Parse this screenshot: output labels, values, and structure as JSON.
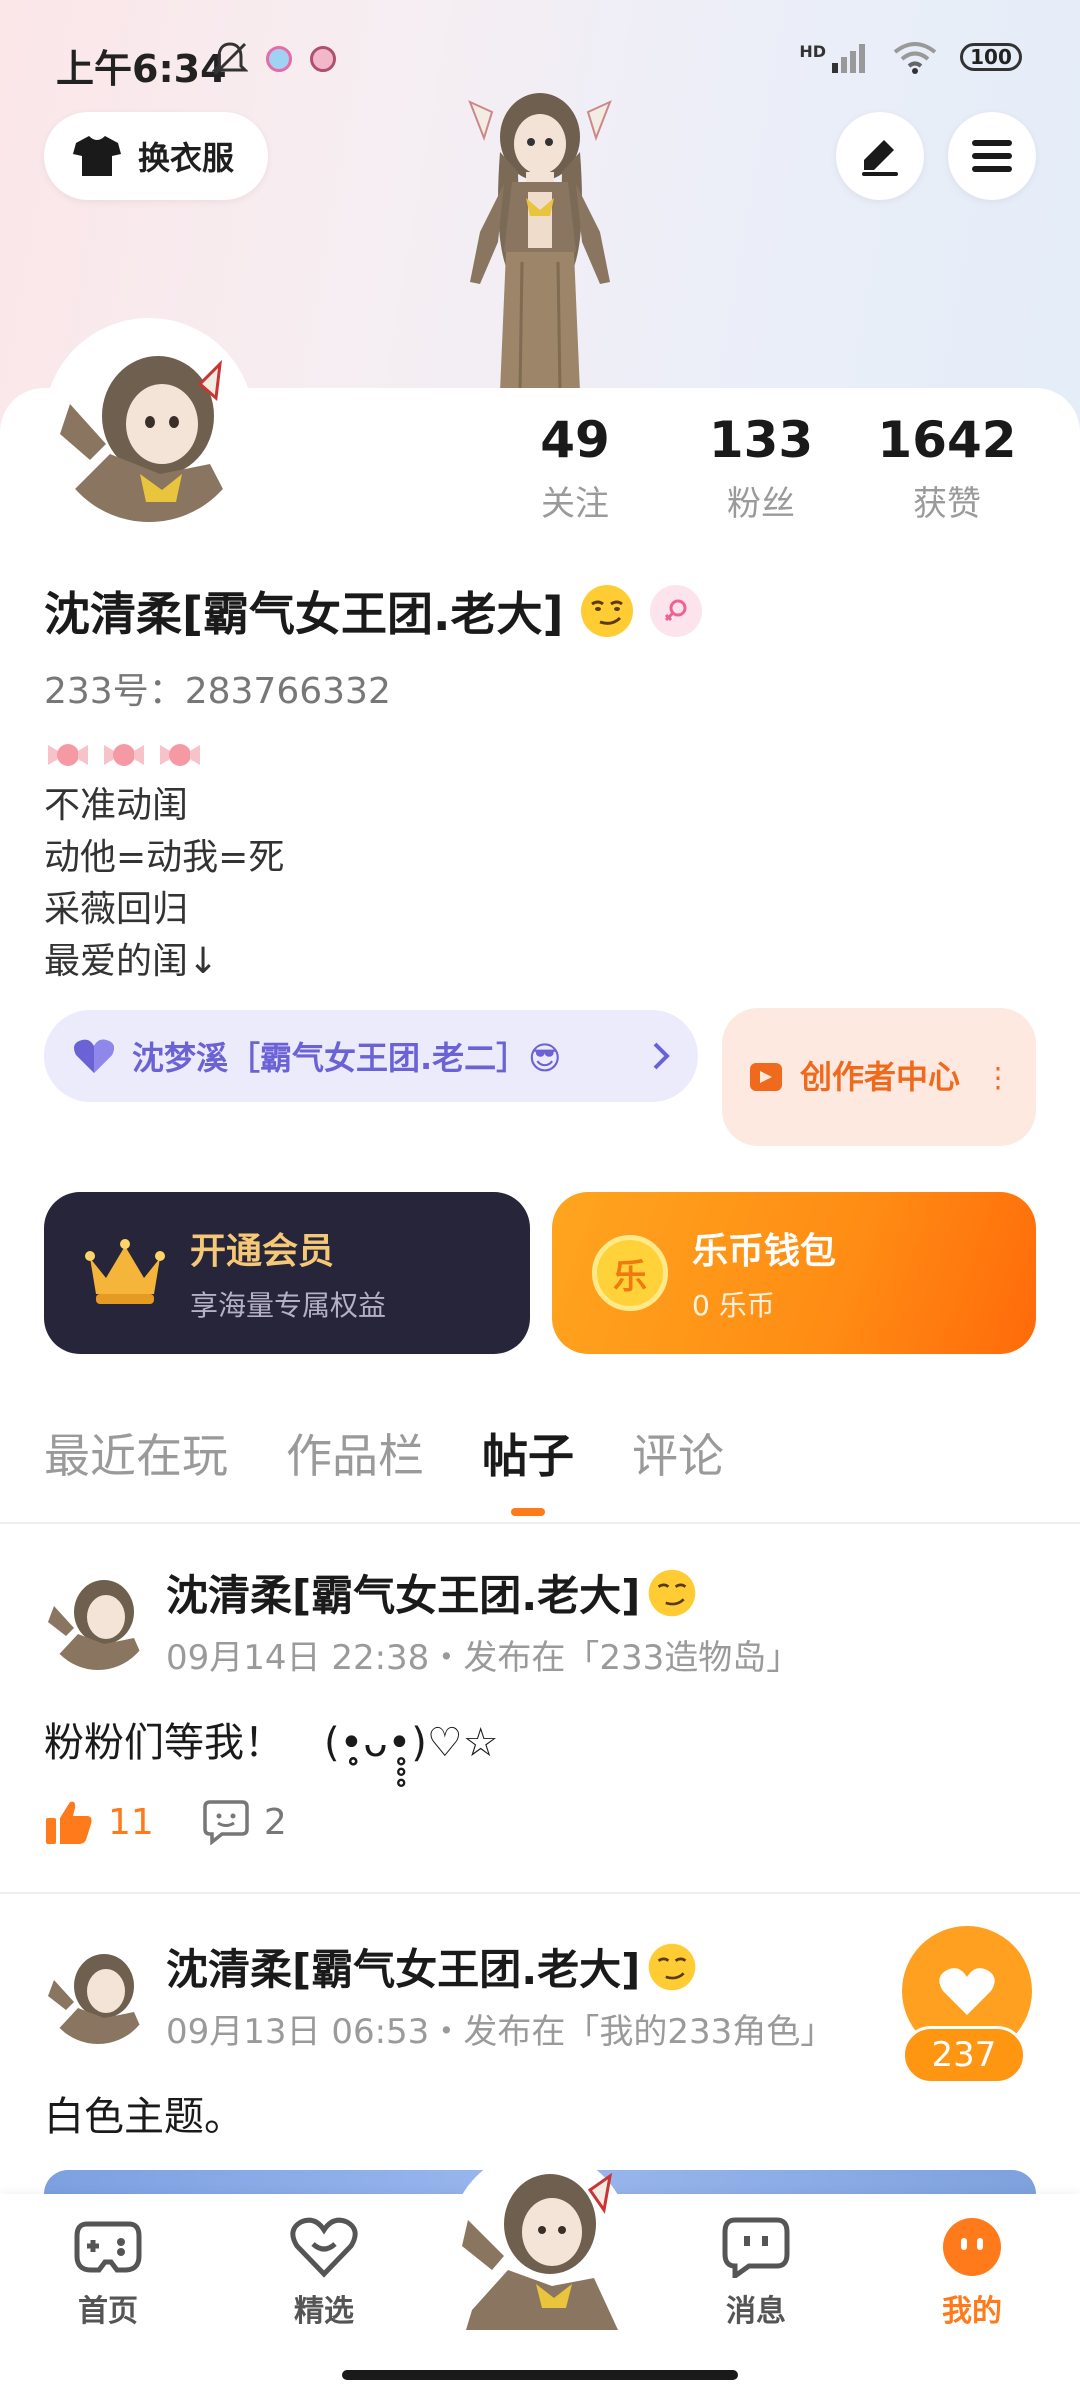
{
  "status": {
    "time": "上午6:34",
    "network": "HD",
    "battery": "100"
  },
  "header": {
    "wardrobe_label": "换衣服"
  },
  "profile": {
    "stats": [
      {
        "value": "49",
        "label": "关注"
      },
      {
        "value": "133",
        "label": "粉丝"
      },
      {
        "value": "1642",
        "label": "获赞"
      }
    ],
    "username": "沈清柔[霸气女王团.老大]",
    "uid": "233号：283766332",
    "bio_lines": [
      "不准动闺",
      "动他=动我=死",
      "采薇回归",
      "最爱的闺↓"
    ]
  },
  "relation": {
    "label": "沈梦溪［霸气女王团.老二］😎"
  },
  "creator": {
    "label": "创作者中心"
  },
  "vip": {
    "title": "开通会员",
    "subtitle": "享海量专属权益"
  },
  "wallet": {
    "title": "乐币钱包",
    "subtitle": "0 乐币",
    "coin_char": "乐"
  },
  "tabs": [
    {
      "label": "最近在玩",
      "active": false
    },
    {
      "label": "作品栏",
      "active": false
    },
    {
      "label": "帖子",
      "active": true
    },
    {
      "label": "评论",
      "active": false
    }
  ],
  "posts": [
    {
      "author": "沈清柔[霸气女王团.老大]",
      "meta": "09月14日 22:38・发布在「233造物岛」",
      "text": "粉粉们等我！　(•̥̥̥ᴗ•̥̥̥)♡☆",
      "likes": "11",
      "comments": "2"
    },
    {
      "author": "沈清柔[霸气女王团.老大]",
      "meta": "09月13日 06:53・发布在「我的233角色」",
      "text": "白色主题。"
    }
  ],
  "float_like": {
    "count": "237"
  },
  "nav": [
    {
      "label": "首页",
      "active": false
    },
    {
      "label": "精选",
      "active": false
    },
    {
      "label": "消息",
      "active": false
    },
    {
      "label": "我的",
      "active": true
    }
  ],
  "colors": {
    "accent": "#ff7a1a",
    "relation_text": "#6b62d6",
    "vip_bg": "#27253a",
    "vip_gold": "#f5c878"
  }
}
